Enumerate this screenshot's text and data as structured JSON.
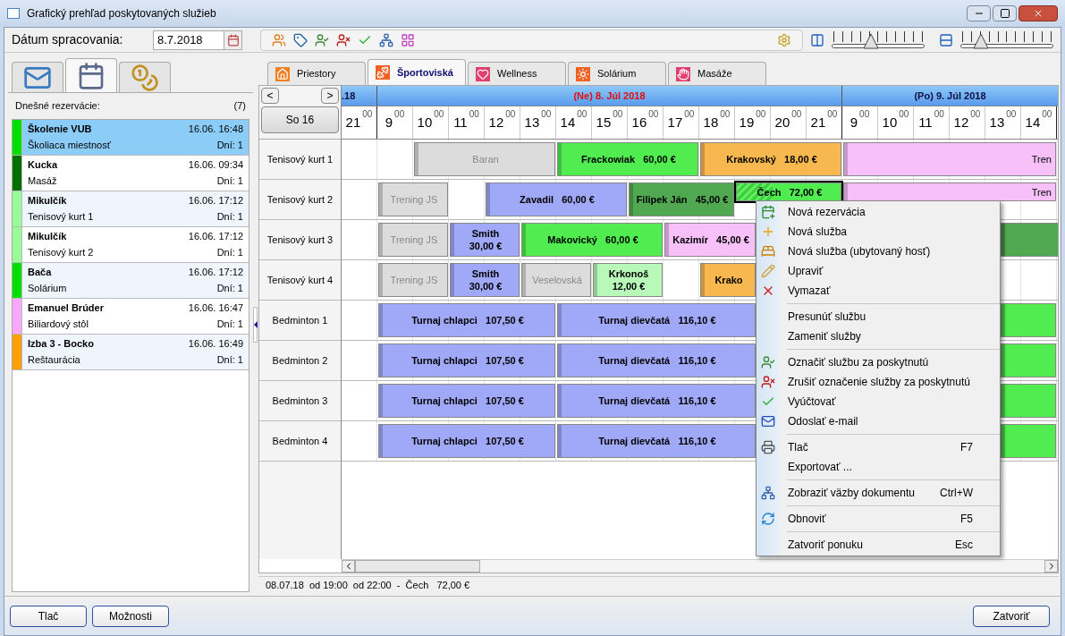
{
  "window": {
    "title": "Grafický prehľad poskytovaných služieb"
  },
  "toolbar": {
    "date_label": "Dátum spracovania:",
    "date_value": "8.7.2018",
    "sliders": [
      {
        "level": 0.42
      },
      {
        "level": 0.22
      }
    ]
  },
  "left_panel": {
    "tabs": [
      {
        "selected": false
      },
      {
        "selected": true
      },
      {
        "selected": false
      }
    ],
    "heading": "Dnešné rezervácie:",
    "count": "(7)",
    "reservations": [
      {
        "name": "Školenie VUB",
        "time": "16.06. 16:48",
        "place": "Školiaca miestnosť",
        "days": "Dní: 1",
        "color": "#00e000",
        "selected": true
      },
      {
        "name": "Kucka",
        "time": "16.06. 09:34",
        "place": "Masáž",
        "days": "Dní: 1",
        "color": "#007000",
        "selected": false
      },
      {
        "name": "Mikulčík",
        "time": "16.06. 17:12",
        "place": "Tenisový kurt 1",
        "days": "Dní: 1",
        "color": "#98fb98",
        "selected": false
      },
      {
        "name": "Mikulčík",
        "time": "16.06. 17:12",
        "place": "Tenisový kurt 2",
        "days": "Dní: 1",
        "color": "#98fb98",
        "selected": false
      },
      {
        "name": "Bača",
        "time": "16.06. 17:12",
        "place": "Solárium",
        "days": "Dní: 1",
        "color": "#00e000",
        "selected": false
      },
      {
        "name": "Emanuel Brúder",
        "time": "16.06. 16:47",
        "place": "Biliardový stôl",
        "days": "Dní: 1",
        "color": "#f8a8f8",
        "selected": false
      },
      {
        "name": "Izba 3 - Bocko",
        "time": "16.06. 16:49",
        "place": "Reštaurácia",
        "days": "Dní: 1",
        "color": "#ffa000",
        "selected": false
      }
    ]
  },
  "tabs": [
    {
      "label": "Priestory",
      "selected": false
    },
    {
      "label": "Športoviská",
      "selected": true
    },
    {
      "label": "Wellness",
      "selected": false
    },
    {
      "label": "Solárium",
      "selected": false
    },
    {
      "label": "Masáže",
      "selected": false
    }
  ],
  "navigation": {
    "prev": "<",
    "next": ">",
    "day_button": "So 16"
  },
  "days": [
    {
      "label": ".18",
      "weekend": false,
      "hours": [
        {
          "hour": "21",
          "minutes": "00"
        }
      ]
    },
    {
      "label": "(Ne) 8. Júl 2018",
      "weekend": true,
      "hours": [
        {
          "hour": "9",
          "minutes": "00"
        },
        {
          "hour": "10",
          "minutes": "00"
        },
        {
          "hour": "11",
          "minutes": "00"
        },
        {
          "hour": "12",
          "minutes": "00"
        },
        {
          "hour": "13",
          "minutes": "00"
        },
        {
          "hour": "14",
          "minutes": "00"
        },
        {
          "hour": "15",
          "minutes": "00"
        },
        {
          "hour": "16",
          "minutes": "00"
        },
        {
          "hour": "17",
          "minutes": "00"
        },
        {
          "hour": "18",
          "minutes": "00"
        },
        {
          "hour": "19",
          "minutes": "00"
        },
        {
          "hour": "20",
          "minutes": "00"
        },
        {
          "hour": "21",
          "minutes": "00"
        }
      ]
    },
    {
      "label": "(Po) 9. Júl 2018",
      "weekend": false,
      "hours": [
        {
          "hour": "9",
          "minutes": "00"
        },
        {
          "hour": "10",
          "minutes": "00"
        },
        {
          "hour": "11",
          "minutes": "00"
        },
        {
          "hour": "12",
          "minutes": "00"
        },
        {
          "hour": "13",
          "minutes": "00"
        },
        {
          "hour": "14",
          "minutes": "00"
        }
      ]
    }
  ],
  "rows": [
    {
      "name": "Tenisový kurt 1",
      "bookings": [
        {
          "text": "Baran",
          "color": "#dcdcdc",
          "kind": "blocked",
          "selected": false
        },
        {
          "text": "Frackowiak   60,00 €",
          "color": "#50ec50",
          "kind": "paid",
          "selected": false
        },
        {
          "text": "Krakovský   18,00 €",
          "color": "#f8b850",
          "kind": "paid",
          "selected": false
        },
        {
          "text": "Tren",
          "color": "#f8c0f8",
          "kind": "cut",
          "selected": false
        }
      ]
    },
    {
      "name": "Tenisový kurt 2",
      "bookings": [
        {
          "text": "Trening JS",
          "color": "#dcdcdc",
          "kind": "blocked",
          "selected": false
        },
        {
          "text": "Zavadil   60,00 €",
          "color": "#a0a8f8",
          "kind": "paid",
          "selected": false
        },
        {
          "text": "Filipek Ján   45,00 €",
          "color": "#50a850",
          "kind": "paid",
          "selected": false
        },
        {
          "text": "Čech   72,00 €",
          "color": "#50ec50",
          "kind": "paid",
          "selected": true
        },
        {
          "text": "Tren",
          "color": "#f8c0f8",
          "kind": "cut",
          "selected": false
        }
      ]
    },
    {
      "name": "Tenisový kurt 3",
      "bookings": [
        {
          "text": "Trening JS",
          "color": "#dcdcdc",
          "kind": "blocked",
          "selected": false
        },
        {
          "text": "Smith   30,00 €",
          "color": "#a0a8f8",
          "kind": "paid",
          "selected": false
        },
        {
          "text": "Makovický   60,00 €",
          "color": "#50ec50",
          "kind": "paid",
          "selected": false
        },
        {
          "text": "Kazimír   45,00 €",
          "color": "#f8c0f8",
          "kind": "paid",
          "selected": false
        },
        {
          "color": "#50a850",
          "kind": "paid",
          "selected": false
        }
      ]
    },
    {
      "name": "Tenisový kurt 4",
      "bookings": [
        {
          "text": "Trening JS",
          "color": "#dcdcdc",
          "kind": "blocked",
          "selected": false
        },
        {
          "text": "Smith   30,00 €",
          "color": "#a0a8f8",
          "kind": "paid",
          "selected": false
        },
        {
          "text": "Veselovská",
          "color": "#dcdcdc",
          "kind": "blocked",
          "selected": false
        },
        {
          "text": "Krkonoš   12,00 €",
          "color": "#b8f8b8",
          "kind": "paid",
          "selected": false
        },
        {
          "text": "Krako",
          "color": "#f8b850",
          "kind": "paid",
          "selected": false
        }
      ]
    },
    {
      "name": "Bedminton 1",
      "bookings": [
        {
          "text": "Turnaj chlapci   107,50 €",
          "color": "#a0a8f8",
          "kind": "paid",
          "selected": false
        },
        {
          "text": "Turnaj dievčatá   116,10 €",
          "color": "#a0a8f8",
          "kind": "paid",
          "selected": false
        },
        {
          "color": "#50ec50",
          "kind": "paid",
          "selected": false
        }
      ]
    },
    {
      "name": "Bedminton 2",
      "bookings": [
        {
          "text": "Turnaj chlapci   107,50 €",
          "color": "#a0a8f8",
          "kind": "paid",
          "selected": false
        },
        {
          "text": "Turnaj dievčatá   116,10 €",
          "color": "#a0a8f8",
          "kind": "paid",
          "selected": false
        },
        {
          "color": "#50ec50",
          "kind": "paid",
          "selected": false
        }
      ]
    },
    {
      "name": "Bedminton 3",
      "bookings": [
        {
          "text": "Turnaj chlapci   107,50 €",
          "color": "#a0a8f8",
          "kind": "paid",
          "selected": false
        },
        {
          "text": "Turnaj dievčatá   116,10 €",
          "color": "#a0a8f8",
          "kind": "paid",
          "selected": false
        },
        {
          "color": "#50ec50",
          "kind": "paid",
          "selected": false
        }
      ]
    },
    {
      "name": "Bedminton 4",
      "bookings": [
        {
          "text": "Turnaj chlapci   107,50 €",
          "color": "#a0a8f8",
          "kind": "paid",
          "selected": false
        },
        {
          "text": "Turnaj dievčatá   116,10 €",
          "color": "#a0a8f8",
          "kind": "paid",
          "selected": false
        },
        {
          "color": "#50ec50",
          "kind": "paid",
          "selected": false
        }
      ]
    }
  ],
  "context_menu": {
    "groups": [
      [
        {
          "label": "Nová rezervácia"
        },
        {
          "label": "Nová služba"
        },
        {
          "label": "Nová služba (ubytovaný hosť)"
        },
        {
          "label": "Upraviť"
        },
        {
          "label": "Vymazať"
        }
      ],
      [
        {
          "label": "Presunúť službu"
        },
        {
          "label": "Zameniť služby"
        }
      ],
      [
        {
          "label": "Označiť službu za poskytnutú"
        },
        {
          "label": "Zrušiť označenie služby za poskytnutú"
        },
        {
          "label": "Vyúčtovať"
        },
        {
          "label": "Odoslať e-mail"
        }
      ],
      [
        {
          "label": "Tlač",
          "shortcut": "F7"
        },
        {
          "label": "Exportovať ..."
        }
      ],
      [
        {
          "label": "Zobraziť väzby dokumentu",
          "shortcut": "Ctrl+W"
        }
      ],
      [
        {
          "label": "Obnoviť",
          "shortcut": "F5"
        }
      ],
      [
        {
          "label": "Zatvoriť ponuku",
          "shortcut": "Esc"
        }
      ]
    ]
  },
  "status_bar": "08.07.18  od 19:00  od 22:00  -  Čech   72,00 €",
  "buttons": {
    "left": [
      "Tlač",
      "Možnosti"
    ],
    "right": [
      "Zatvoriť"
    ]
  }
}
